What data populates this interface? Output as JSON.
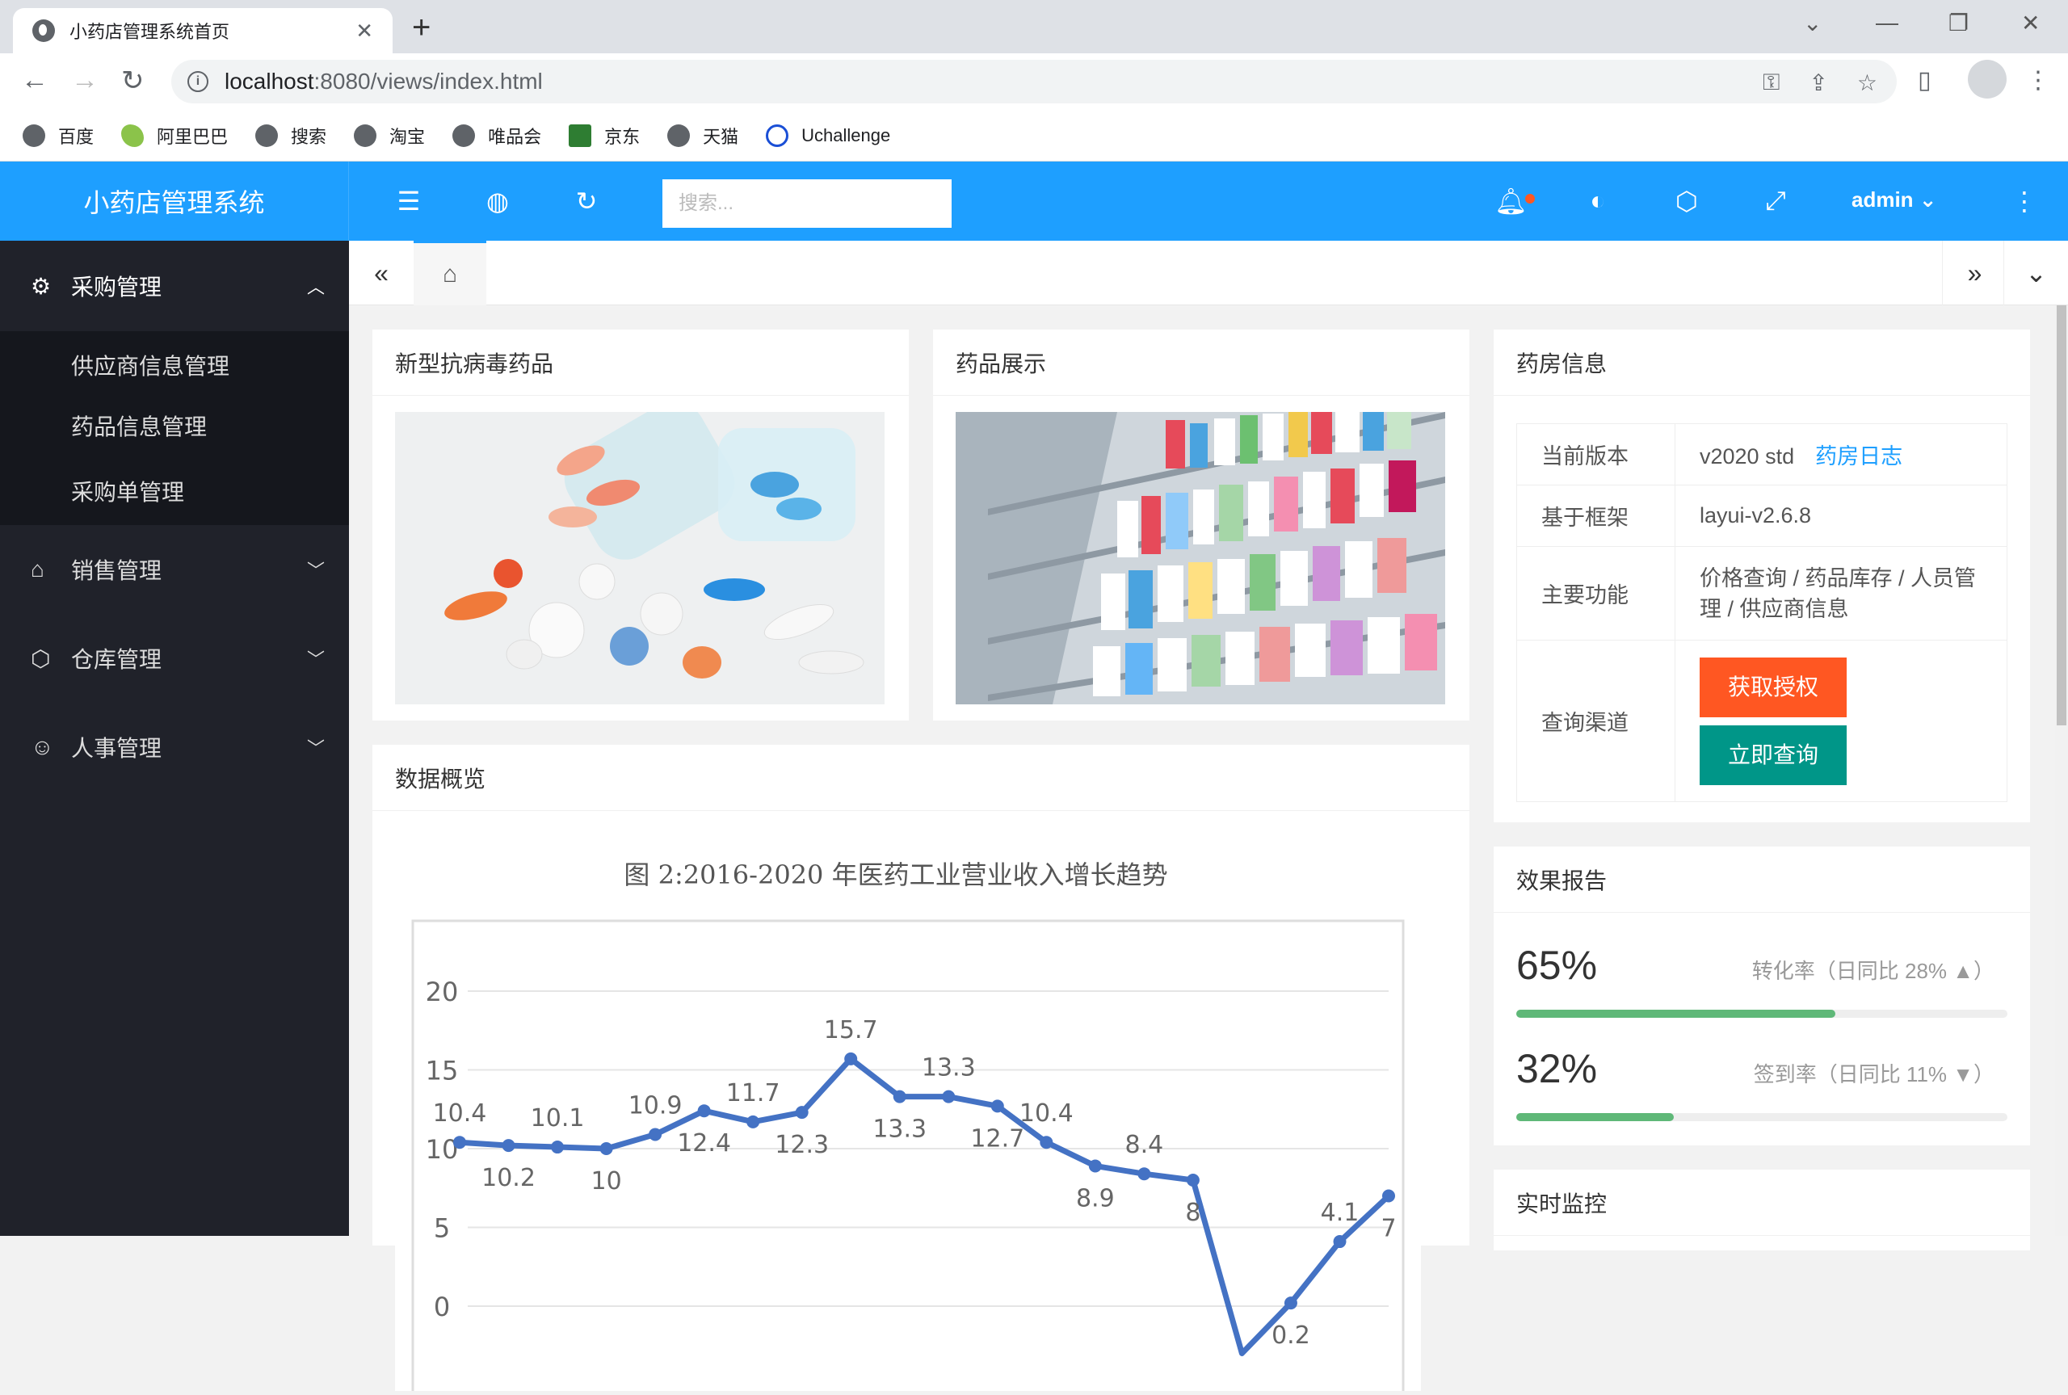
{
  "browser": {
    "tab_title": "小药店管理系统首页",
    "url_host": "localhost",
    "url_rest": ":8080/views/index.html",
    "bookmarks": [
      "百度",
      "阿里巴巴",
      "搜索",
      "淘宝",
      "唯品会",
      "京东",
      "天猫",
      "Uchallenge"
    ]
  },
  "header": {
    "logo": "小药店管理系统",
    "search_placeholder": "搜索...",
    "user": "admin"
  },
  "sidebar": {
    "groups": [
      {
        "label": "采购管理",
        "expanded": true,
        "icon": "gear-icon",
        "items": [
          "供应商信息管理",
          "药品信息管理",
          "采购单管理"
        ]
      },
      {
        "label": "销售管理",
        "expanded": false,
        "icon": "home-icon"
      },
      {
        "label": "仓库管理",
        "expanded": false,
        "icon": "box-icon"
      },
      {
        "label": "人事管理",
        "expanded": false,
        "icon": "user-icon"
      }
    ]
  },
  "cards": {
    "drugs_title": "新型抗病毒药品",
    "display_title": "药品展示",
    "overview_title": "数据概览",
    "pharmacy_title": "药房信息",
    "report_title": "效果报告",
    "monitor_title": "实时监控"
  },
  "pharmacy": {
    "version_label": "当前版本",
    "version_value": "v2020 std",
    "version_link": "药房日志",
    "framework_label": "基于框架",
    "framework_value": "layui-v2.6.8",
    "features_label": "主要功能",
    "features_value": "价格查询 / 药品库存 / 人员管理 / 供应商信息",
    "channel_label": "查询渠道",
    "btn_auth": "获取授权",
    "btn_query": "立即查询"
  },
  "report": {
    "conversion_value": "65%",
    "conversion_fill": 0.65,
    "conversion_label": "转化率（日同比 28% ▲）",
    "signin_value": "32%",
    "signin_fill": 0.32,
    "signin_label": "签到率（日同比 11% ▼）"
  },
  "chart_data": {
    "type": "line",
    "title": "图 2:2016-2020 年医药工业营业收入增长趋势",
    "ylim": [
      0,
      20
    ],
    "yticks": [
      "20",
      "15",
      "10",
      "5",
      "0"
    ],
    "values": [
      10.4,
      10.2,
      10.1,
      10,
      10.9,
      12.4,
      11.7,
      12.3,
      15.7,
      13.3,
      13.3,
      12.7,
      10.4,
      8.9,
      8.4,
      8,
      -3,
      0.2,
      4.1,
      7
    ],
    "labels": [
      "10.4",
      "10.2",
      "10.1",
      "10",
      "10.9",
      "12.4",
      "11.7",
      "12.3",
      "15.7",
      "13.3",
      "13.3",
      "12.7",
      "10.4",
      "8.9",
      "8.4",
      "8",
      "",
      "0.2",
      "4.1",
      "7"
    ],
    "color": "#4472c4"
  }
}
